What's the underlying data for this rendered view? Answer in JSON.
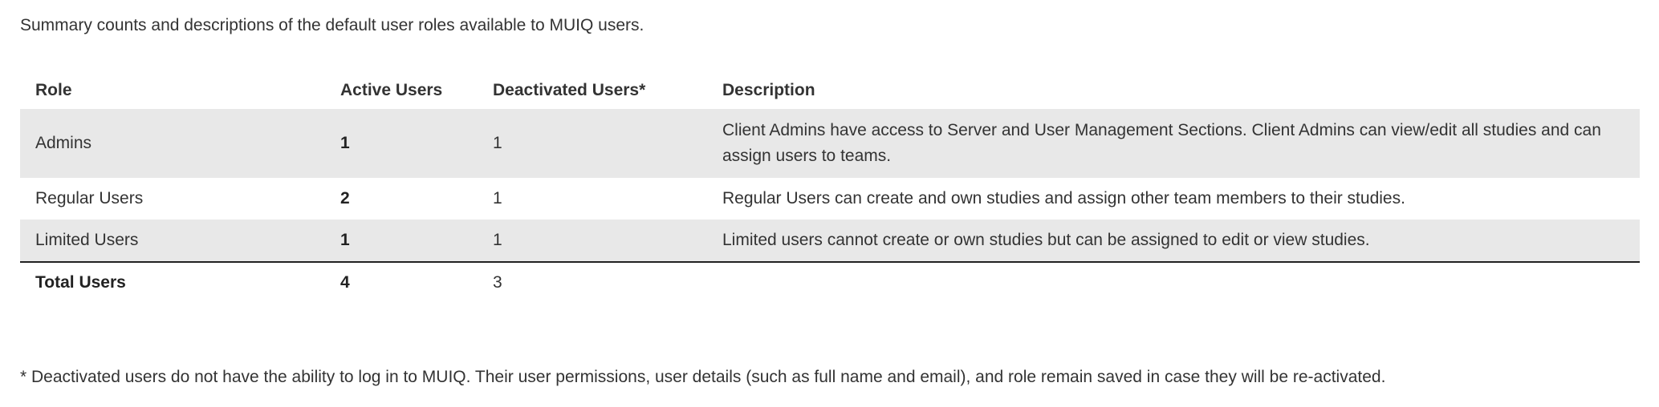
{
  "summary_text": "Summary counts and descriptions of the default user roles available to MUIQ users.",
  "table": {
    "headers": {
      "role": "Role",
      "active": "Active Users",
      "deactivated": "Deactivated Users*",
      "description": "Description"
    },
    "rows": [
      {
        "role": "Admins",
        "active": "1",
        "deactivated": "1",
        "description": "Client Admins have access to Server and User Management Sections. Client Admins can view/edit all studies and can assign users to teams."
      },
      {
        "role": "Regular Users",
        "active": "2",
        "deactivated": "1",
        "description": "Regular Users can create and own studies and assign other team members to their studies."
      },
      {
        "role": "Limited Users",
        "active": "1",
        "deactivated": "1",
        "description": "Limited users cannot create or own studies but can be assigned to edit or view studies."
      }
    ],
    "total": {
      "label": "Total Users",
      "active": "4",
      "deactivated": "3"
    }
  },
  "footnote": "* Deactivated users do not have the ability to log in to MUIQ. Their user permissions, user details (such as full name and email), and role remain saved in case they will be re-activated.",
  "colors": {
    "row_shade": "#e8e8e8",
    "text": "#333333",
    "divider": "#222222"
  }
}
